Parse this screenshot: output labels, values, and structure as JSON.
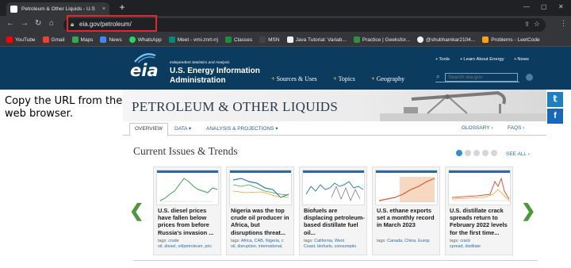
{
  "browser": {
    "tab_title": "Petroleum & Other Liquids - U.S",
    "tab_close": "×",
    "new_tab": "+",
    "url": "eia.gov/petroleum/",
    "win_min": "⌄",
    "bookmarks": [
      {
        "label": "YouTube",
        "color": "#ff0000"
      },
      {
        "label": "Gmail",
        "color": "#ea4335"
      },
      {
        "label": "Maps",
        "color": "#34a853"
      },
      {
        "label": "News",
        "color": "#4285f4"
      },
      {
        "label": "WhatsApp",
        "color": "#25d366"
      },
      {
        "label": "Meet - vmi-znrt-rrj",
        "color": "#00897b"
      },
      {
        "label": "Classes",
        "color": "#1e8e3e"
      },
      {
        "label": "MSN",
        "color": "#444444"
      },
      {
        "label": "Java Tutorial: Variab...",
        "color": "#f2f2f2"
      },
      {
        "label": "Practice | Geeksfor...",
        "color": "#2f8d46"
      },
      {
        "label": "@shubhamkar2104...",
        "color": "#f2f2f2"
      },
      {
        "label": "Problems - LeetCode",
        "color": "#ffa116"
      }
    ]
  },
  "eia": {
    "logo_text": "eia",
    "logo_small": "Independent Statistics and Analysis",
    "logo_line1": "U.S. Energy Information",
    "logo_line2": "Administration",
    "nav": [
      "Sources & Uses",
      "Topics",
      "Geography"
    ],
    "util": [
      "Tools",
      "Learn About Energy",
      "News"
    ],
    "search_placeholder": "Search eia.gov"
  },
  "annotation": "Copy the URL from the web browser.",
  "page": {
    "title": "PETROLEUM & OTHER LIQUIDS",
    "subnav": {
      "overview": "OVERVIEW",
      "data": "DATA ▾",
      "analysis": "ANALYSIS & PROJECTIONS ▾",
      "glossary": "GLOSSARY ›",
      "faqs": "FAQS ›"
    },
    "social": {
      "twitter": "𝕥",
      "facebook": "f"
    },
    "section_title": "Current Issues & Trends",
    "see_all": "SEE ALL ›",
    "prev_arrow": "❮",
    "next_arrow": "❯",
    "cards": [
      {
        "headline": "U.S. diesel prices have fallen below prices from before Russia's invasion ...",
        "tags_label": "tags:",
        "tags_line1": "crude",
        "tags_line2": "oil, diesel, oil/petroleum, pric"
      },
      {
        "headline": "Nigeria was the top crude oil producer in Africa, but disruptions threat...",
        "tags_label": "tags:",
        "tags_line1": "Africa, CAB, Nigeria, c",
        "tags_line2": "oil, disruption, international,"
      },
      {
        "headline": "Biofuels are displacing petroleum-based distillate fuel oil...",
        "tags_label": "tags:",
        "tags_line1": "California, West",
        "tags_line2": "Coast, biofuels, consumptio"
      },
      {
        "headline": "U.S. ethane exports set a monthly record in March 2023",
        "tags_label": "tags:",
        "tags_line1": "Canada, China, Europ",
        "tags_line2": ""
      },
      {
        "headline": "U.S. distillate crack spreads return to February 2022 levels for the first time...",
        "tags_label": "tags:",
        "tags_line1": "crack",
        "tags_line2": "spread, distillate"
      }
    ]
  },
  "colors": {
    "header_bg": "#0b3b5f",
    "accent_gold": "#f1c232",
    "link_blue": "#2a6ea8",
    "carousel_dot_active": "#2b8fd6",
    "arrow_green": "#4a9a3a",
    "highlight_red": "#e0282f"
  }
}
